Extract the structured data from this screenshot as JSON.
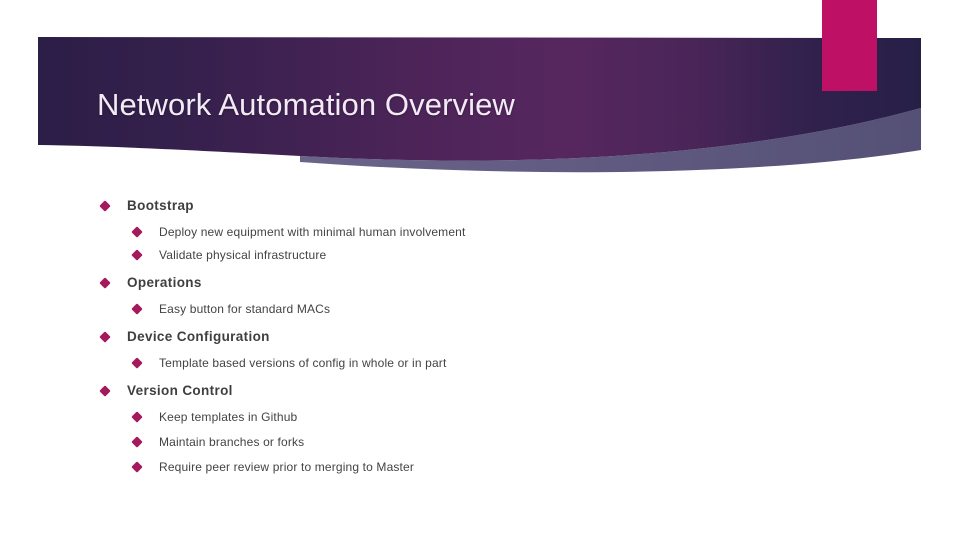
{
  "slide": {
    "title": "Network Automation Overview",
    "colors": {
      "banner_dark_navy": "#2b1e47",
      "banner_purple": "#54265d",
      "banner_right_navy": "#262047",
      "accent_pink": "#be1165",
      "swoosh_gray_purple": "#5a5477",
      "bullet_diamond": "#a51a5d",
      "title_text": "#f2eaf5",
      "body_text": "#3f3f3f",
      "background": "#ffffff"
    },
    "decor": {
      "accent_bar_name": "pink-accent-bar",
      "banner_name": "title-banner-shape",
      "swoosh_name": "banner-swoosh-shape"
    },
    "bullets": [
      {
        "level": 1,
        "text": "Bootstrap",
        "marker": "diamond-bullet"
      },
      {
        "level": 2,
        "text": "Deploy new equipment with minimal human involvement",
        "marker": "diamond-bullet"
      },
      {
        "level": 2,
        "text": "Validate physical infrastructure",
        "marker": "diamond-bullet"
      },
      {
        "level": 1,
        "text": "Operations",
        "marker": "diamond-bullet"
      },
      {
        "level": 2,
        "text": "Easy button for standard MACs",
        "marker": "diamond-bullet"
      },
      {
        "level": 1,
        "text": "Device Configuration",
        "marker": "diamond-bullet"
      },
      {
        "level": 2,
        "text": "Template based versions of config in whole or in part",
        "marker": "diamond-bullet"
      },
      {
        "level": 1,
        "text": "Version Control",
        "marker": "diamond-bullet"
      },
      {
        "level": 2,
        "text": "Keep templates in Github",
        "marker": "diamond-bullet"
      },
      {
        "level": 2,
        "text": "Maintain branches or forks",
        "marker": "diamond-bullet"
      },
      {
        "level": 2,
        "text": "Require peer review prior to merging to Master",
        "marker": "diamond-bullet"
      }
    ]
  }
}
